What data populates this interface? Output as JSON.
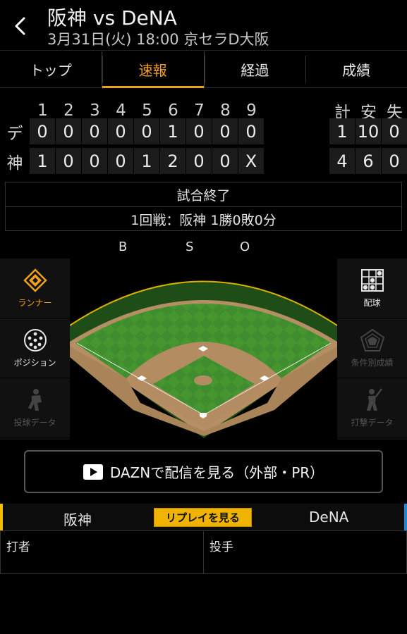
{
  "header": {
    "title": "阪神 vs DeNA",
    "subtitle": "3月31日(火) 18:00 京セラD大阪",
    "back_icon": "chevron-left-icon"
  },
  "tabs": [
    {
      "label": "トップ",
      "active": false
    },
    {
      "label": "速報",
      "active": true
    },
    {
      "label": "経過",
      "active": false
    },
    {
      "label": "成績",
      "active": false
    }
  ],
  "scoreboard": {
    "innings": [
      "1",
      "2",
      "3",
      "4",
      "5",
      "6",
      "7",
      "8",
      "9"
    ],
    "totals_headers": [
      "計",
      "安",
      "失"
    ],
    "teams": [
      {
        "label": "デ",
        "scores": [
          "0",
          "0",
          "0",
          "0",
          "0",
          "1",
          "0",
          "0",
          "0"
        ],
        "totals": [
          "1",
          "10",
          "0"
        ]
      },
      {
        "label": "神",
        "scores": [
          "1",
          "0",
          "0",
          "0",
          "1",
          "2",
          "0",
          "0",
          "X"
        ],
        "totals": [
          "4",
          "6",
          "0"
        ]
      }
    ]
  },
  "result": {
    "status": "試合終了",
    "series": "1回戦：阪神 1勝0敗0分"
  },
  "bso": {
    "b": "B",
    "s": "S",
    "o": "O"
  },
  "left_panel": [
    {
      "label": "ランナー",
      "icon": "runner-diamond-icon",
      "state": "active"
    },
    {
      "label": "ポジション",
      "icon": "position-dots-icon",
      "state": "normal"
    },
    {
      "label": "投球データ",
      "icon": "pitcher-icon",
      "state": "disabled"
    }
  ],
  "right_panel": [
    {
      "label": "配球",
      "icon": "pitch-grid-icon",
      "state": "normal"
    },
    {
      "label": "条件別成績",
      "icon": "radar-chart-icon",
      "state": "disabled"
    },
    {
      "label": "打撃データ",
      "icon": "batter-icon",
      "state": "disabled"
    }
  ],
  "dazn_button": {
    "label": "DAZNで配信を見る（外部・PR）",
    "icon": "play-icon"
  },
  "team_bar": {
    "home": "阪神",
    "away": "DeNA",
    "replay": "リプレイを見る",
    "home_color": "#f0c000",
    "away_color": "#1a8ad4"
  },
  "players": {
    "batter": "打者",
    "pitcher": "投手"
  },
  "colors": {
    "accent": "#f0a020",
    "grass": "#3a8a2a",
    "dirt": "#b08a60"
  }
}
